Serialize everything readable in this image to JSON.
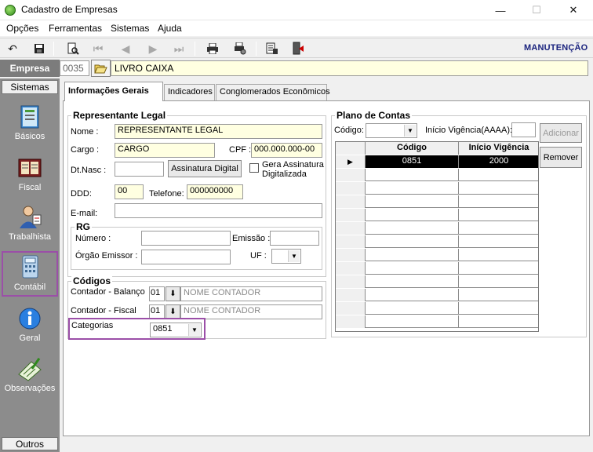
{
  "window": {
    "title": "Cadastro de Empresas"
  },
  "menu": [
    "Opções",
    "Ferramentas",
    "Sistemas",
    "Ajuda"
  ],
  "toolbar": {
    "mode": "MANUTENÇÃO"
  },
  "empresa": {
    "label": "Empresa",
    "code": "0035",
    "name": "LIVRO CAIXA"
  },
  "sidebar": {
    "header": "Sistemas",
    "footer": "Outros",
    "items": [
      {
        "label": "Básicos",
        "icon": "book-icon"
      },
      {
        "label": "Fiscal",
        "icon": "ledger-icon"
      },
      {
        "label": "Trabalhista",
        "icon": "worker-icon"
      },
      {
        "label": "Contábil",
        "icon": "calculator-icon",
        "active": true
      },
      {
        "label": "Geral",
        "icon": "info-icon"
      },
      {
        "label": "Observações",
        "icon": "notepad-icon"
      }
    ]
  },
  "tabs": [
    "Informações Gerais",
    "Indicadores",
    "Conglomerados Econômicos"
  ],
  "representante": {
    "title": "Representante Legal",
    "nome_label": "Nome :",
    "nome": "REPRESENTANTE LEGAL",
    "cargo_label": "Cargo :",
    "cargo": "CARGO",
    "cpf_label": "CPF :",
    "cpf": "000.000.000-00",
    "dtnasc_label": "Dt.Nasc :",
    "dtnasc": "",
    "assinatura_btn": "Assinatura Digital",
    "gera_label_1": "Gera Assinatura",
    "gera_label_2": "Digitalizada",
    "ddd_label": "DDD:",
    "ddd": "00",
    "telefone_label": "Telefone:",
    "telefone": "000000000",
    "email_label": "E-mail:",
    "email": ""
  },
  "rg": {
    "title": "RG",
    "numero_label": "Número :",
    "numero": "",
    "emissao_label": "Emissão :",
    "emissao": "",
    "orgao_label": "Órgão Emissor :",
    "orgao": "",
    "uf_label": "UF :",
    "uf": ""
  },
  "codigos": {
    "title": "Códigos",
    "balanco_label": "Contador - Balanço",
    "balanco_code": "01",
    "balanco_name": "NOME CONTADOR",
    "fiscal_label": "Contador - Fiscal",
    "fiscal_code": "01",
    "fiscal_name": "NOME CONTADOR",
    "categorias_label": "Categorias",
    "categorias": "0851"
  },
  "plano": {
    "title": "Plano de Contas",
    "codigo_label": "Código:",
    "codigo": "",
    "vigencia_label": "Início Vigência(AAAA):",
    "vigencia": "",
    "adicionar": "Adicionar",
    "remover": "Remover",
    "columns": [
      "Código",
      "Início Vigência"
    ],
    "rows": [
      {
        "codigo": "0851",
        "vigencia": "2000"
      }
    ]
  }
}
